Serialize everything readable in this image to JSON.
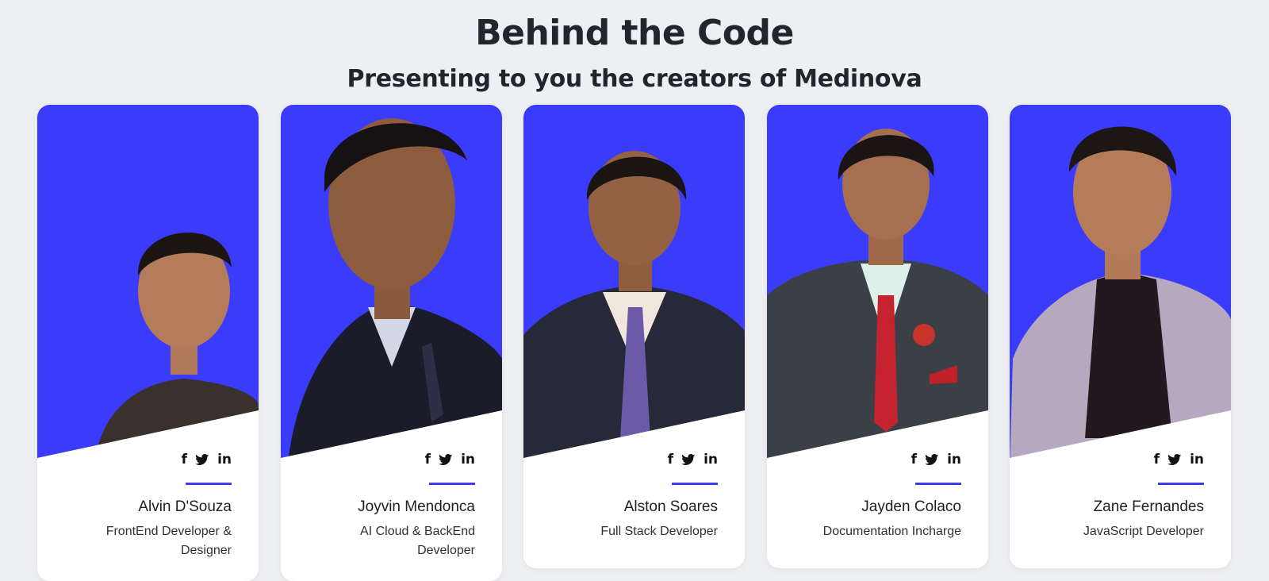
{
  "header": {
    "title": "Behind the Code",
    "subtitle": "Presenting to you the creators of Medinova"
  },
  "colors": {
    "accent": "#3c3cf2",
    "photo_bg": "#3b3bfb",
    "card_bg": "#ffffff",
    "page_bg": "#eeeff2"
  },
  "social_icons": [
    "facebook-icon",
    "twitter-icon",
    "linkedin-icon"
  ],
  "team": [
    {
      "name": "Alvin D'Souza",
      "role": "FrontEnd Developer & Designer",
      "outfit": "#3a302c"
    },
    {
      "name": "Joyvin Mendonca",
      "role": "AI Cloud & BackEnd Developer",
      "outfit": "#1b1c2a"
    },
    {
      "name": "Alston Soares",
      "role": "Full Stack Developer",
      "outfit": "#262a38"
    },
    {
      "name": "Jayden Colaco",
      "role": "Documentation Incharge",
      "outfit": "#3b4046"
    },
    {
      "name": "Zane Fernandes",
      "role": "JavaScript Developer",
      "outfit": "#b5a8bf"
    }
  ]
}
